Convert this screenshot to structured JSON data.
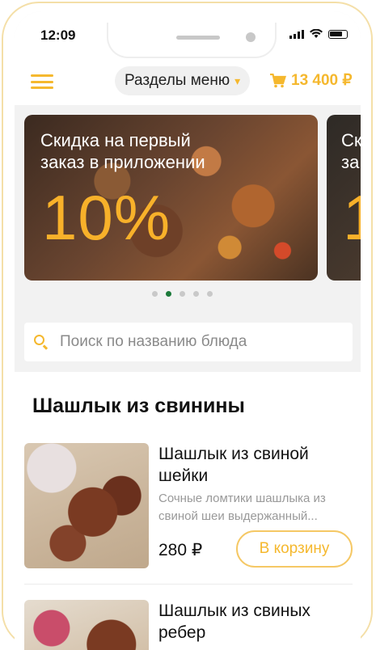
{
  "status_bar": {
    "time": "12:09"
  },
  "header": {
    "sections_label": "Разделы меню",
    "cart_total": "13 400 ₽",
    "accent_color": "#f5b82e"
  },
  "banner": {
    "text": "Скидка на первый заказ в приложении",
    "big": "10%",
    "next_text": "Ск за",
    "next_big": "1"
  },
  "carousel": {
    "dots": 5,
    "active_index": 1
  },
  "search": {
    "placeholder": "Поиск по названию блюда",
    "value": ""
  },
  "category": {
    "title": "Шашлык из свинины"
  },
  "items": [
    {
      "name": "Шашлык из свиной шейки",
      "description": "Сочные ломтики шашлыка из свиной шеи выдержанный...",
      "price": "280 ₽",
      "button": "В корзину"
    },
    {
      "name": "Шашлык из свиных ребер"
    }
  ]
}
